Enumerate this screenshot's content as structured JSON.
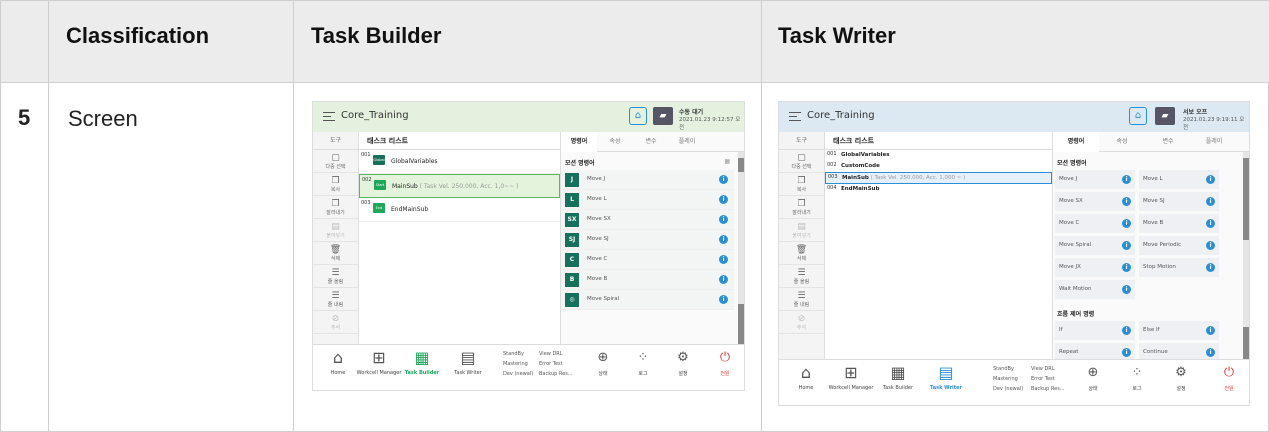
{
  "table": {
    "headers": [
      "Classification",
      "Task Builder",
      "Task Writer"
    ],
    "row_number": "5",
    "row_label": "Screen"
  },
  "colors": {
    "header_bg": "#ececec",
    "builder_bar": "#e4f1df",
    "writer_bar": "#dde9f2",
    "accent_green": "#17705b",
    "accent_blue": "#2a8fd6",
    "power_red": "#e53935"
  },
  "builder": {
    "title": "Core_Training",
    "mode": "수동 대기",
    "datetime": "2021.01.23 9:12:57 오전",
    "tool_header": "도구",
    "tools": [
      {
        "label": "다중 선택",
        "icon": "multi-select-icon",
        "glyph": "▢",
        "enabled": true
      },
      {
        "label": "복사",
        "icon": "copy-icon",
        "glyph": "❐",
        "enabled": true
      },
      {
        "label": "잘라내기",
        "icon": "cut-icon",
        "glyph": "❐",
        "enabled": true
      },
      {
        "label": "붙여넣기",
        "icon": "paste-icon",
        "glyph": "▤",
        "enabled": false
      },
      {
        "label": "삭제",
        "icon": "delete-icon",
        "glyph": "🗑",
        "enabled": true
      },
      {
        "label": "줄 올림",
        "icon": "indent-icon",
        "glyph": "☰",
        "enabled": true
      },
      {
        "label": "줄 내림",
        "icon": "outdent-icon",
        "glyph": "☰",
        "enabled": true
      },
      {
        "label": "주석",
        "icon": "comment-icon",
        "glyph": "⊘",
        "enabled": false
      }
    ],
    "task_list_title": "태스크 리스트",
    "tasks": [
      {
        "no": "001",
        "badge": "Global Var.",
        "badge_color": "#17705b",
        "name": "GlobalVariables",
        "params": ""
      },
      {
        "no": "002",
        "badge": "Start",
        "badge_color": "#1fa75a",
        "name": "MainSub",
        "params": "( Task Vel. 250.000, Acc. 1,0~~ )"
      },
      {
        "no": "003",
        "badge": "End",
        "badge_color": "#1fa75a",
        "name": "EndMainSub",
        "params": ""
      }
    ],
    "tabs": [
      "명령어",
      "속성",
      "변수",
      "플레이"
    ],
    "section": "모션 명령어",
    "commands": [
      {
        "icon": "J",
        "label": "Move J"
      },
      {
        "icon": "L",
        "label": "Move L"
      },
      {
        "icon": "SX",
        "label": "Move SX"
      },
      {
        "icon": "SJ",
        "label": "Move SJ"
      },
      {
        "icon": "C",
        "label": "Move C"
      },
      {
        "icon": "B",
        "label": "Move B"
      },
      {
        "icon": "◎",
        "label": "Move Spiral"
      }
    ],
    "bottom_nav": [
      {
        "label": "Home",
        "icon": "home-icon",
        "glyph": "⌂"
      },
      {
        "label": "Workcell Manager",
        "icon": "workcell-icon",
        "glyph": "⊞"
      },
      {
        "label": "Task Builder",
        "icon": "task-builder-icon",
        "glyph": "▦"
      },
      {
        "label": "Task Writer",
        "icon": "task-writer-icon",
        "glyph": "▤"
      }
    ],
    "mini_links": [
      "StandBy",
      "Mastering",
      "Dev (newal)",
      "View DRL",
      "Error Test",
      "Backup Res..."
    ],
    "status_items": [
      {
        "label": "상태",
        "icon": "status-icon",
        "glyph": "⊕"
      },
      {
        "label": "로그",
        "icon": "log-icon",
        "glyph": "⁘"
      },
      {
        "label": "설정",
        "icon": "settings-icon",
        "glyph": "⚙"
      },
      {
        "label": "전원",
        "icon": "power-icon",
        "glyph": "⏻"
      }
    ]
  },
  "writer": {
    "title": "Core_Training",
    "mode": "서보 오프",
    "datetime": "2021.01.23 9:19:11 오전",
    "tool_header": "도구",
    "tools": [
      {
        "label": "다중 선택",
        "icon": "multi-select-icon",
        "glyph": "▢",
        "enabled": true
      },
      {
        "label": "복사",
        "icon": "copy-icon",
        "glyph": "❐",
        "enabled": true
      },
      {
        "label": "잘라내기",
        "icon": "cut-icon",
        "glyph": "❐",
        "enabled": true
      },
      {
        "label": "붙여넣기",
        "icon": "paste-icon",
        "glyph": "▤",
        "enabled": false
      },
      {
        "label": "삭제",
        "icon": "delete-icon",
        "glyph": "🗑",
        "enabled": true
      },
      {
        "label": "줄 올림",
        "icon": "indent-icon",
        "glyph": "☰",
        "enabled": true
      },
      {
        "label": "줄 내림",
        "icon": "outdent-icon",
        "glyph": "☰",
        "enabled": true
      },
      {
        "label": "주석",
        "icon": "comment-icon",
        "glyph": "⊘",
        "enabled": false
      }
    ],
    "task_list_title": "태스크 리스트",
    "tasks": [
      {
        "no": "001",
        "name": "GlobalVariables",
        "params": ""
      },
      {
        "no": "002",
        "name": "CustomCode",
        "params": ""
      },
      {
        "no": "003",
        "name": "MainSub",
        "params": "( Task Vel. 250.000, Acc. 1,000 ~ )"
      },
      {
        "no": "004",
        "name": "EndMainSub",
        "params": ""
      }
    ],
    "tabs": [
      "명령어",
      "속성",
      "변수",
      "플레이"
    ],
    "section_motion": "모션 명령어",
    "motion_cells": [
      "Move J",
      "Move L",
      "Move SX",
      "Move SJ",
      "Move C",
      "Move B",
      "Move Spiral",
      "Move Periodic",
      "Move JX",
      "Stop Motion",
      "Wait Motion"
    ],
    "section_flow": "흐름 제어 명령",
    "flow_cells": [
      "If",
      "Else If",
      "Repeat",
      "Continue"
    ],
    "bottom_nav": [
      {
        "label": "Home",
        "icon": "home-icon",
        "glyph": "⌂"
      },
      {
        "label": "Workcell Manager",
        "icon": "workcell-icon",
        "glyph": "⊞"
      },
      {
        "label": "Task Builder",
        "icon": "task-builder-icon",
        "glyph": "▦"
      },
      {
        "label": "Task Writer",
        "icon": "task-writer-icon",
        "glyph": "▤"
      }
    ],
    "mini_links": [
      "StandBy",
      "Mastering",
      "Dev (newal)",
      "View DRL",
      "Error Test",
      "Backup Res..."
    ],
    "status_items": [
      {
        "label": "상태",
        "icon": "status-icon",
        "glyph": "⊕"
      },
      {
        "label": "로그",
        "icon": "log-icon",
        "glyph": "⁘"
      },
      {
        "label": "설정",
        "icon": "settings-icon",
        "glyph": "⚙"
      },
      {
        "label": "전원",
        "icon": "power-icon",
        "glyph": "⏻"
      }
    ]
  }
}
